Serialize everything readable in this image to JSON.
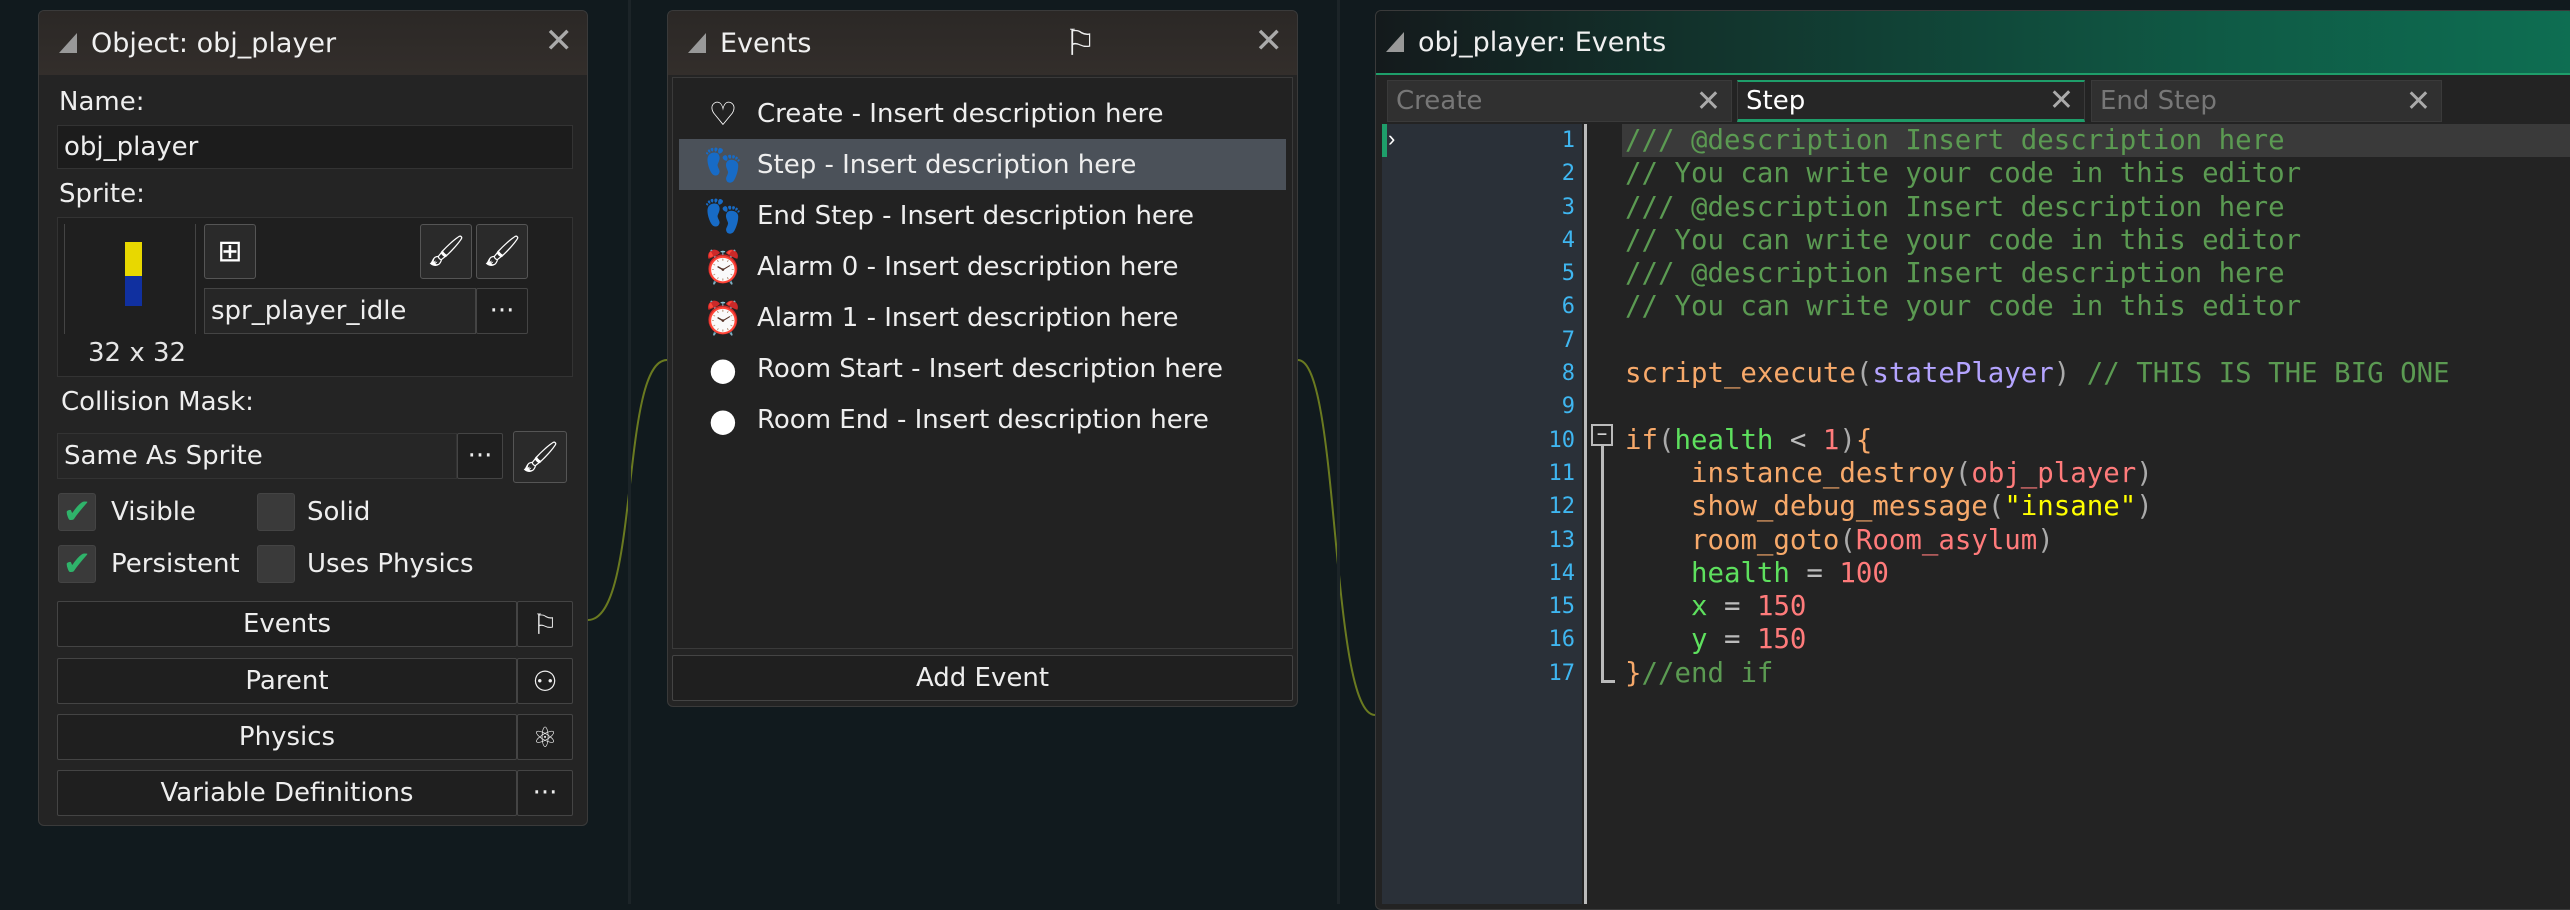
{
  "object_panel": {
    "title": "Object: obj_player",
    "name_label": "Name:",
    "name_value": "obj_player",
    "sprite_label": "Sprite:",
    "sprite_size": "32 x 32",
    "sprite_value": "spr_player_idle",
    "browse": "···",
    "collision_label": "Collision Mask:",
    "collision_value": "Same As Sprite",
    "checkboxes": [
      {
        "label": "Visible",
        "checked": true
      },
      {
        "label": "Solid",
        "checked": false
      },
      {
        "label": "Persistent",
        "checked": true
      },
      {
        "label": "Uses Physics",
        "checked": false
      }
    ],
    "buttons": [
      {
        "label": "Events",
        "icon": "flag-icon"
      },
      {
        "label": "Parent",
        "icon": "hierarchy-icon"
      },
      {
        "label": "Physics",
        "icon": "atom-icon"
      },
      {
        "label": "Variable Definitions",
        "icon": "ellipsis-icon"
      }
    ]
  },
  "events_panel": {
    "title": "Events",
    "items": [
      {
        "label": "Create - Insert description here",
        "icon": "lightbulb-outline-icon"
      },
      {
        "label": "Step - Insert description here",
        "icon": "footsteps-icon",
        "selected": true
      },
      {
        "label": "End Step - Insert description here",
        "icon": "footsteps-icon"
      },
      {
        "label": "Alarm 0 - Insert description here",
        "icon": "alarm-clock-icon"
      },
      {
        "label": "Alarm 1 - Insert description here",
        "icon": "alarm-clock-icon"
      },
      {
        "label": "Room Start - Insert description here",
        "icon": "lightbulb-icon"
      },
      {
        "label": "Room End - Insert description here",
        "icon": "lightbulb-icon"
      }
    ],
    "add_event": "Add Event"
  },
  "code_panel": {
    "title": "obj_player: Events",
    "tabs": [
      {
        "label": "Create",
        "active": false
      },
      {
        "label": "Step",
        "active": true
      },
      {
        "label": "End Step",
        "active": false
      }
    ],
    "line_numbers": [
      "1",
      "2",
      "3",
      "4",
      "5",
      "6",
      "7",
      "8",
      "9",
      "10",
      "11",
      "12",
      "13",
      "14",
      "15",
      "16",
      "17"
    ],
    "lines": [
      [
        [
          "/// @description Insert description here",
          "comment"
        ]
      ],
      [
        [
          "// You can write your code in this editor",
          "comment"
        ]
      ],
      [
        [
          "/// @description Insert description here",
          "comment"
        ]
      ],
      [
        [
          "// You can write your code in this editor",
          "comment"
        ]
      ],
      [
        [
          "/// @description Insert description here",
          "comment"
        ]
      ],
      [
        [
          "// You can write your code in this editor",
          "comment"
        ]
      ],
      [],
      [
        [
          "script_execute",
          "func"
        ],
        [
          "(",
          "paren"
        ],
        [
          "statePlayer",
          "script"
        ],
        [
          ")",
          "paren"
        ],
        [
          " // THIS IS THE BIG ONE",
          "comment"
        ]
      ],
      [],
      [
        [
          "if",
          "kw"
        ],
        [
          "(",
          "paren"
        ],
        [
          "health",
          "var"
        ],
        [
          " < ",
          "op"
        ],
        [
          "1",
          "num"
        ],
        [
          ")",
          "paren"
        ],
        [
          "{",
          "kw"
        ]
      ],
      [
        [
          "    ",
          "plain"
        ],
        [
          "instance_destroy",
          "func"
        ],
        [
          "(",
          "paren"
        ],
        [
          "obj_player",
          "obj"
        ],
        [
          ")",
          "paren"
        ]
      ],
      [
        [
          "    ",
          "plain"
        ],
        [
          "show_debug_message",
          "func"
        ],
        [
          "(",
          "paren"
        ],
        [
          "\"insane\"",
          "str"
        ],
        [
          ")",
          "paren"
        ]
      ],
      [
        [
          "    ",
          "plain"
        ],
        [
          "room_goto",
          "func"
        ],
        [
          "(",
          "paren"
        ],
        [
          "Room_asylum",
          "obj"
        ],
        [
          ")",
          "paren"
        ]
      ],
      [
        [
          "    ",
          "plain"
        ],
        [
          "health",
          "var"
        ],
        [
          " = ",
          "op"
        ],
        [
          "100",
          "num"
        ]
      ],
      [
        [
          "    ",
          "plain"
        ],
        [
          "x",
          "var"
        ],
        [
          " = ",
          "op"
        ],
        [
          "150",
          "num"
        ]
      ],
      [
        [
          "    ",
          "plain"
        ],
        [
          "y",
          "var"
        ],
        [
          " = ",
          "op"
        ],
        [
          "150",
          "num"
        ]
      ],
      [
        [
          "}",
          "kw"
        ],
        [
          "//end if",
          "comment"
        ]
      ]
    ]
  }
}
